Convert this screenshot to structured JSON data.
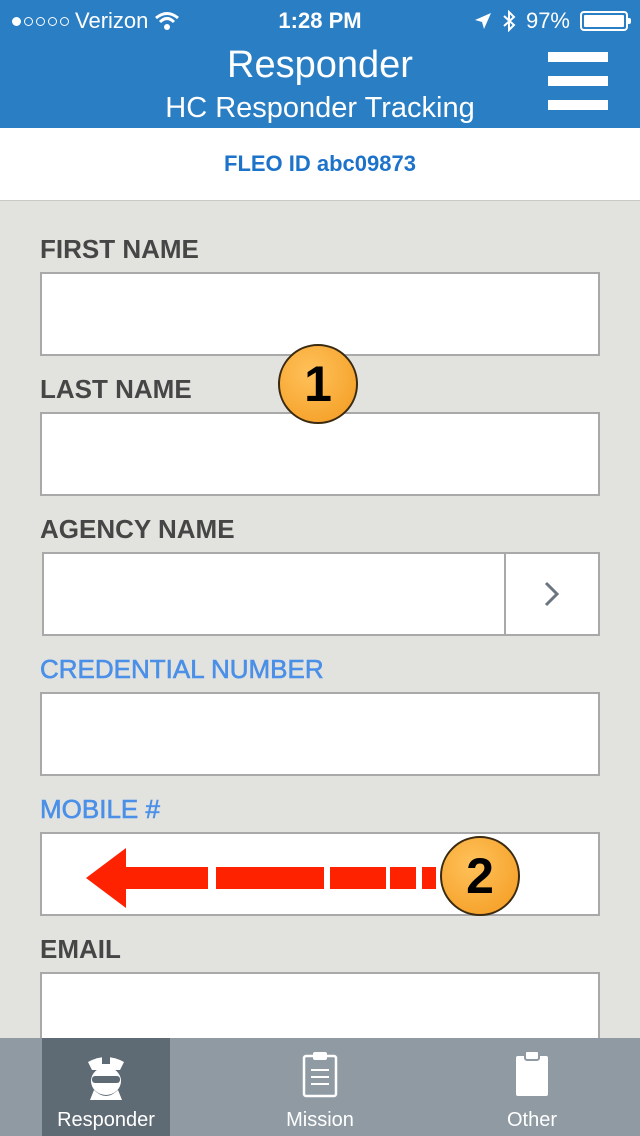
{
  "status_bar": {
    "carrier": "Verizon",
    "time": "1:28 PM",
    "battery": "97%",
    "battery_level": 0.97
  },
  "header": {
    "title": "Responder",
    "subtitle": "HC Responder Tracking"
  },
  "id_strip": {
    "text": "FLEO ID abc09873"
  },
  "form": {
    "first_name_label": "FIRST NAME",
    "first_name_value": "",
    "last_name_label": "LAST NAME",
    "last_name_value": "",
    "agency_name_label": "AGENCY NAME",
    "agency_name_value": "",
    "credential_label": "CREDENTIAL NUMBER",
    "credential_value": "",
    "mobile_label": "MOBILE #",
    "mobile_value": "",
    "email_label": "EMAIL",
    "email_value": ""
  },
  "annotations": {
    "marker_1": "1",
    "marker_2": "2"
  },
  "colors": {
    "header": "#2a7ec4",
    "accent_blue": "#4a8fe8",
    "annotation_orange": "#f39a1e",
    "arrow_red": "#ff2200",
    "tabbar": "#8f9aa3"
  },
  "tabs": [
    {
      "label": "Responder",
      "icon": "police-officer-icon",
      "active": true
    },
    {
      "label": "Mission",
      "icon": "clipboard-list-icon",
      "active": false
    },
    {
      "label": "Other",
      "icon": "clipboard-icon",
      "active": false
    }
  ]
}
